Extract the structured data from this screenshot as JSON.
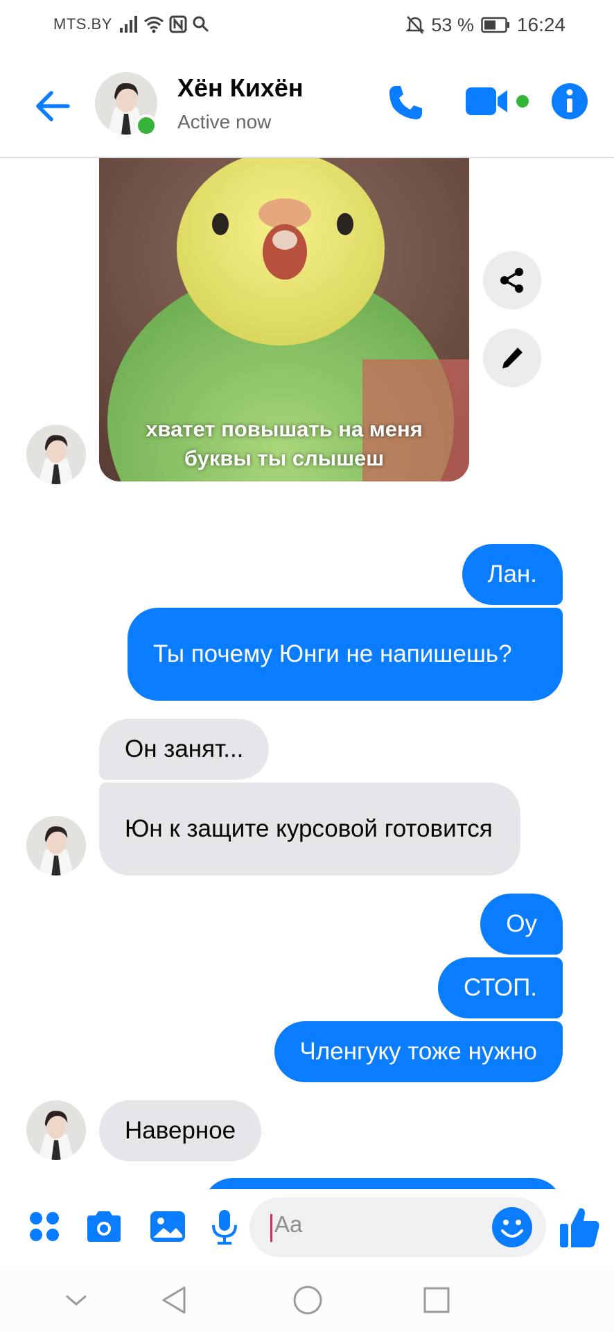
{
  "status_bar": {
    "carrier": "MTS.BY",
    "battery": "53 %",
    "time": "16:24",
    "icons": [
      "signal-icon",
      "wifi-icon",
      "nfc-icon",
      "search-icon",
      "mute-icon",
      "battery-icon"
    ]
  },
  "header": {
    "contact_name": "Хён Кихён",
    "status": "Active now",
    "icons": [
      "back-arrow-icon",
      "phone-icon",
      "video-camera-icon",
      "info-icon"
    ],
    "online": true
  },
  "sticker": {
    "caption": "хватет повышать на меня буквы ты слышеш",
    "actions": [
      "share-icon",
      "pencil-icon"
    ]
  },
  "messages": [
    {
      "id": "m1",
      "side": "out",
      "text": "Лан."
    },
    {
      "id": "m2",
      "side": "out",
      "text": "Ты почему Юнги не напишешь?"
    },
    {
      "id": "m3",
      "side": "in",
      "text": "Он занят..."
    },
    {
      "id": "m4",
      "side": "in",
      "text": "Юн к защите курсовой готовится"
    },
    {
      "id": "m5",
      "side": "out",
      "text": "Оу"
    },
    {
      "id": "m6",
      "side": "out",
      "text": "СТОП."
    },
    {
      "id": "m7",
      "side": "out",
      "text": "Членгуку тоже нужно"
    },
    {
      "id": "m8",
      "side": "in",
      "text": "Наверное"
    }
  ],
  "composer": {
    "placeholder": "Aa",
    "icons": [
      "apps-grid-icon",
      "camera-icon",
      "gallery-icon",
      "microphone-icon",
      "emoji-icon",
      "thumbs-up-icon"
    ]
  },
  "navigation": {
    "icons": [
      "hide-chevron-icon",
      "back-triangle-icon",
      "home-circle-icon",
      "recents-square-icon"
    ]
  },
  "colors": {
    "accent": "#0a7cff",
    "incoming_bubble": "#e6e5ea",
    "online": "#35b63a"
  }
}
